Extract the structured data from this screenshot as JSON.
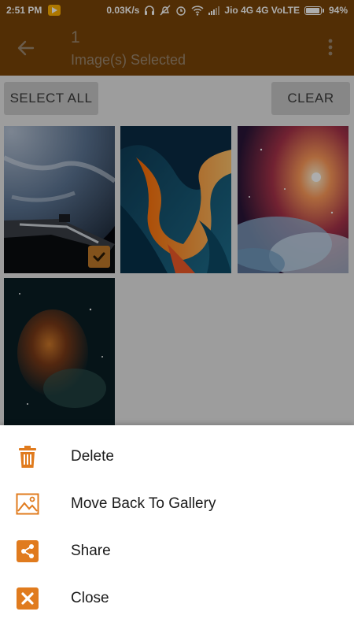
{
  "status_bar": {
    "time": "2:51 PM",
    "network_speed": "0.03K/s",
    "carrier": "Jio 4G 4G VoLTE",
    "battery": "94%",
    "battery_level": 0.94
  },
  "app_bar": {
    "selected_count": "1",
    "subtitle": "Image(s) Selected"
  },
  "actions": {
    "select_all": "SELECT ALL",
    "clear": "CLEAR"
  },
  "images": [
    {
      "name": "earth-space-image",
      "selected": true
    },
    {
      "name": "abstract-waves-image",
      "selected": false
    },
    {
      "name": "nebula-clouds-image",
      "selected": false
    },
    {
      "name": "cosmic-pillar-image",
      "selected": false
    }
  ],
  "sheet": {
    "items": [
      {
        "label": "Delete",
        "icon": "trash-icon"
      },
      {
        "label": "Move Back To Gallery",
        "icon": "image-icon"
      },
      {
        "label": "Share",
        "icon": "share-icon"
      },
      {
        "label": "Close",
        "icon": "close-icon"
      }
    ]
  },
  "colors": {
    "app_bar": "#7a4508",
    "accent": "#e07b1e"
  }
}
